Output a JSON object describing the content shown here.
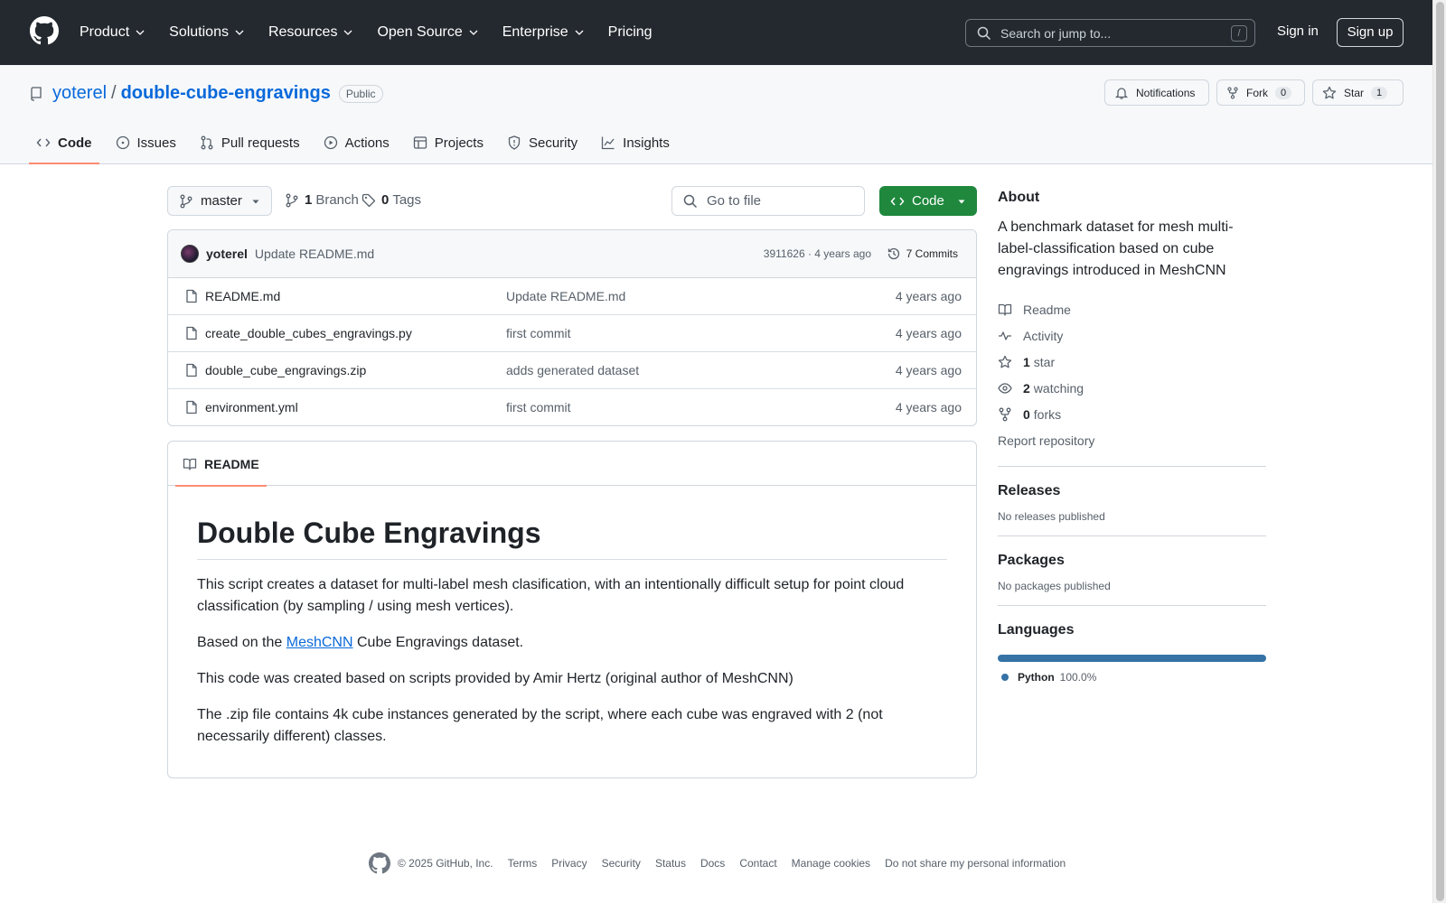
{
  "header": {
    "nav": [
      {
        "label": "Product",
        "dropdown": true
      },
      {
        "label": "Solutions",
        "dropdown": true
      },
      {
        "label": "Resources",
        "dropdown": true
      },
      {
        "label": "Open Source",
        "dropdown": true
      },
      {
        "label": "Enterprise",
        "dropdown": true
      },
      {
        "label": "Pricing",
        "dropdown": false
      }
    ],
    "search_placeholder": "Search or jump to...",
    "search_shortcut": "/",
    "signin": "Sign in",
    "signup": "Sign up"
  },
  "repo": {
    "owner": "yoterel",
    "separator": "/",
    "name": "double-cube-engravings",
    "visibility": "Public",
    "notifications_label": "Notifications",
    "fork_label": "Fork",
    "fork_count": "0",
    "star_label": "Star",
    "star_count": "1",
    "tabs": [
      "Code",
      "Issues",
      "Pull requests",
      "Actions",
      "Projects",
      "Security",
      "Insights"
    ]
  },
  "filenav": {
    "branch": "master",
    "branch_count": "1",
    "branch_label": "Branch",
    "tag_count": "0",
    "tag_label": "Tags",
    "goto_placeholder": "Go to file",
    "code_label": "Code"
  },
  "commit": {
    "author": "yoterel",
    "message": "Update README.md",
    "meta": "3911626 · 4 years ago",
    "count_label": "7 Commits"
  },
  "files": [
    {
      "name": "README.md",
      "message": "Update README.md",
      "age": "4 years ago"
    },
    {
      "name": "create_double_cubes_engravings.py",
      "message": "first commit",
      "age": "4 years ago"
    },
    {
      "name": "double_cube_engravings.zip",
      "message": "adds generated dataset",
      "age": "4 years ago"
    },
    {
      "name": "environment.yml",
      "message": "first commit",
      "age": "4 years ago"
    }
  ],
  "readme": {
    "tab_label": "README",
    "title": "Double Cube Engravings",
    "p1": "This script creates a dataset for multi-label mesh clasification, with an intentionally difficult setup for point cloud classification (by sampling / using mesh vertices).",
    "p2_before": "Based on the ",
    "p2_link": "MeshCNN",
    "p2_after": " Cube Engravings dataset.",
    "p3": "This code was created based on scripts provided by Amir Hertz (original author of MeshCNN)",
    "p4": "The .zip file contains 4k cube instances generated by the script, where each cube was engraved with 2 (not necessarily different) classes."
  },
  "sidebar": {
    "about_title": "About",
    "about_desc": "A benchmark dataset for mesh multi-label-classification based on cube engravings introduced in MeshCNN",
    "readme_link": "Readme",
    "activity_link": "Activity",
    "stars_count": "1",
    "stars_label": "star",
    "watching_count": "2",
    "watching_label": "watching",
    "forks_count": "0",
    "forks_label": "forks",
    "report_link": "Report repository",
    "releases_title": "Releases",
    "releases_empty": "No releases published",
    "packages_title": "Packages",
    "packages_empty": "No packages published",
    "languages_title": "Languages",
    "language_name": "Python",
    "language_pct": "100.0%",
    "language_fraction": 1.0,
    "language_color": "#3572A5"
  },
  "footer": {
    "copyright": "© 2025 GitHub, Inc.",
    "links": [
      "Terms",
      "Privacy",
      "Security",
      "Status",
      "Docs",
      "Contact",
      "Manage cookies",
      "Do not share my personal information"
    ]
  },
  "colors": {
    "header_bg": "#24292f",
    "link": "#0969da",
    "primary_button": "#1f883d",
    "active_tab_underline": "#fd8c73"
  }
}
